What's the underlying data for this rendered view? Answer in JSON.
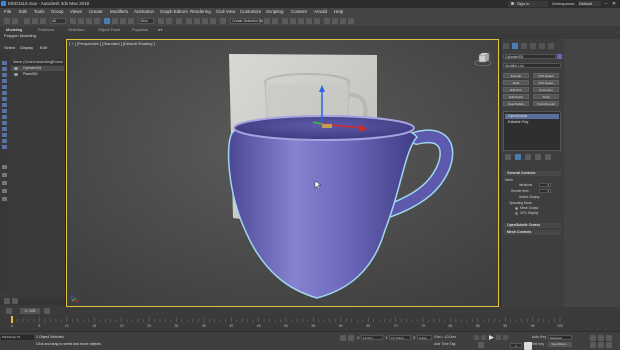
{
  "window": {
    "title": "MSD1110.max - Autodesk 3ds Max 2018",
    "sign_in": "Sign In",
    "workspaces_label": "Workspaces:",
    "workspace_value": "Default"
  },
  "menu": [
    "File",
    "Edit",
    "Tools",
    "Group",
    "Views",
    "Create",
    "Modifiers",
    "Animation",
    "Graph Editors",
    "Rendering",
    "Civil View",
    "Customize",
    "Scripting",
    "Content",
    "Arnold",
    "Help"
  ],
  "toolbar": {
    "filter_value": "All",
    "view_value": "View",
    "selection_set_placeholder": "Create Selection Se"
  },
  "ribbon": {
    "tabs": [
      "Modeling",
      "Freeform",
      "Selection",
      "Object Paint",
      "Populate"
    ],
    "active_tab": "Modeling",
    "sub_label": "Polygon Modeling"
  },
  "scene_explorer": {
    "tabs": [
      "Select",
      "Display",
      "Edit"
    ],
    "sort_header": "Name (Sorted Ascending)",
    "frozen_header": "Frozen",
    "rows": [
      {
        "name": "Cylinder001",
        "selected": true
      },
      {
        "name": "Plane001",
        "selected": false
      }
    ]
  },
  "viewport": {
    "label": "[ + ] [Perspective ] [Standard ] [Default Shading ]",
    "mug_color": "#6a66b8",
    "selection_outline_color": "#9fd6f0",
    "border_color": "#e0c242"
  },
  "command_panel": {
    "object_name": "Cylinder001",
    "modifier_list": "Modifier List",
    "modifier_buttons": [
      "Extrude",
      "FFD Select",
      "Shell",
      "FFD Select",
      "Edit Poly",
      "Symmetry",
      "Edit Patch",
      "Push",
      "OpenSubdiv",
      "TurboSmooth"
    ],
    "stack": [
      {
        "name": "OpenSubdiv",
        "selected": true
      },
      {
        "name": "Editable Poly",
        "selected": false
      }
    ],
    "rollouts": {
      "general_controls": "General Controls",
      "opensubdiv_crease": "OpenSubdiv Crease",
      "mesh_controls": "Mesh Controls"
    },
    "props": {
      "mesh": "Mesh",
      "iterations_label": "Iterations",
      "iterations_value": "2",
      "render_iters_label": "Render Iters",
      "render_iters_value": "2",
      "isoline_display": "Isoline Display",
      "operating_mode": "Operating Mode",
      "mesh_output": "Mesh Output",
      "gpu_display": "GPU Display"
    }
  },
  "timeline": {
    "slider_label": "0 / 100",
    "ticks": [
      "0",
      "5",
      "10",
      "15",
      "20",
      "25",
      "30",
      "35",
      "40",
      "45",
      "50",
      "55",
      "60",
      "65",
      "70",
      "75",
      "80",
      "85",
      "90",
      "95",
      "100"
    ]
  },
  "status": {
    "maxscript": "MAXScript Mi",
    "selection": "1 Object Selected",
    "prompt": "Click and drag to select and move objects",
    "x_label": "X:",
    "x_value": "15.0cm",
    "y_label": "Y:",
    "y_value": "13.716cm",
    "z_label": "Z:",
    "z_value": "0.0cm",
    "grid": "Grid = 10.0cm",
    "add_time_tag": "Add Time Tag",
    "frame": "0",
    "auto_key": "Auto Key",
    "set_key": "Set Key",
    "selected": "Selected",
    "key_filters": "Key Filters..."
  }
}
